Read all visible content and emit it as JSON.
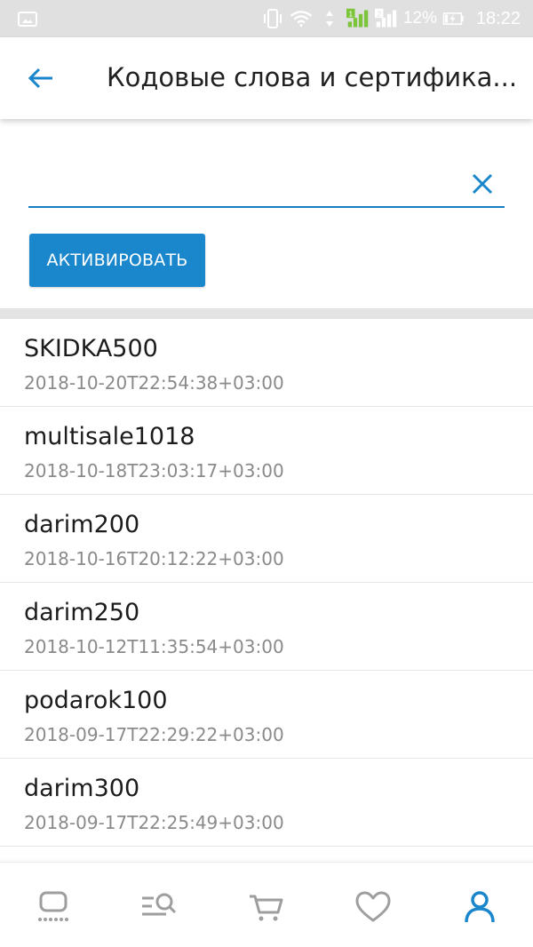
{
  "status_bar": {
    "battery_percent": "12%",
    "time": "18:22",
    "sim1_label": "1",
    "sim2_label": "2"
  },
  "app_bar": {
    "title": "Кодовые слова и сертифика..."
  },
  "search": {
    "value": "",
    "placeholder": ""
  },
  "activate_button": {
    "label": "АКТИВИРОВАТЬ"
  },
  "codes": [
    {
      "name": "SKIDKA500",
      "date": "2018-10-20T22:54:38+03:00"
    },
    {
      "name": "multisale1018",
      "date": "2018-10-18T23:03:17+03:00"
    },
    {
      "name": "darim200",
      "date": "2018-10-16T20:12:22+03:00"
    },
    {
      "name": "darim250",
      "date": "2018-10-12T11:35:54+03:00"
    },
    {
      "name": "podarok100",
      "date": "2018-09-17T22:29:22+03:00"
    },
    {
      "name": "darim300",
      "date": "2018-09-17T22:25:49+03:00"
    }
  ],
  "bottom_nav": {
    "items": [
      "home-icon",
      "catalog-search-icon",
      "cart-icon",
      "favorites-heart-icon",
      "profile-icon"
    ],
    "active": "profile-icon"
  },
  "colors": {
    "accent": "#1a86cc",
    "status_bar_bg": "#e0e0e0",
    "nav_inactive": "#9e9e9e",
    "nav_active": "#1a86cc",
    "sim1_green": "#7cc43a"
  }
}
